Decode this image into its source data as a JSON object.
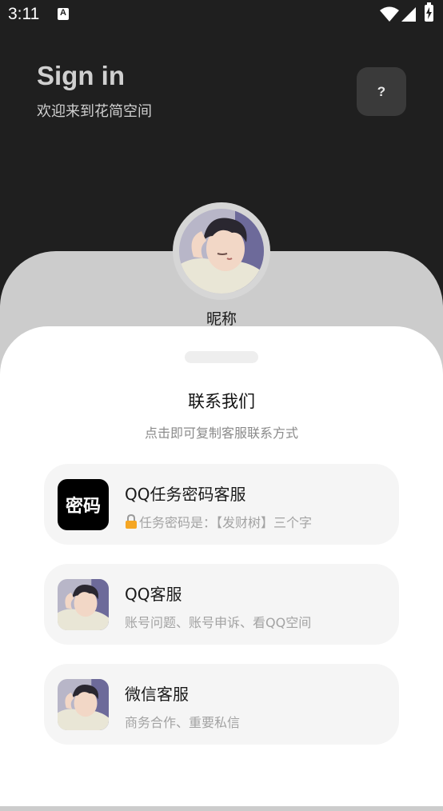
{
  "status_bar": {
    "time": "3:11",
    "icons": [
      "notification-a-icon",
      "wifi-icon",
      "signal-icon",
      "battery-charging-icon"
    ]
  },
  "header": {
    "title": "Sign in",
    "subtitle": "欢迎来到花简空间",
    "help_label": "?"
  },
  "profile": {
    "nickname": "昵称"
  },
  "sheet": {
    "title": "联系我们",
    "subtitle": "点击即可复制客服联系方式",
    "items": [
      {
        "icon_text": "密码",
        "title": "QQ任务密码客服",
        "desc": "任务密码是：【发财树】三个字"
      },
      {
        "title": "QQ客服",
        "desc": "账号问题、账号申诉、看QQ空间"
      },
      {
        "title": "微信客服",
        "desc": "商务合作、重要私信"
      }
    ]
  },
  "colors": {
    "background": "#1f1f1f",
    "card": "#cccccc",
    "sheet": "#ffffff",
    "item": "#f5f5f5",
    "lock": "#f5a623"
  }
}
